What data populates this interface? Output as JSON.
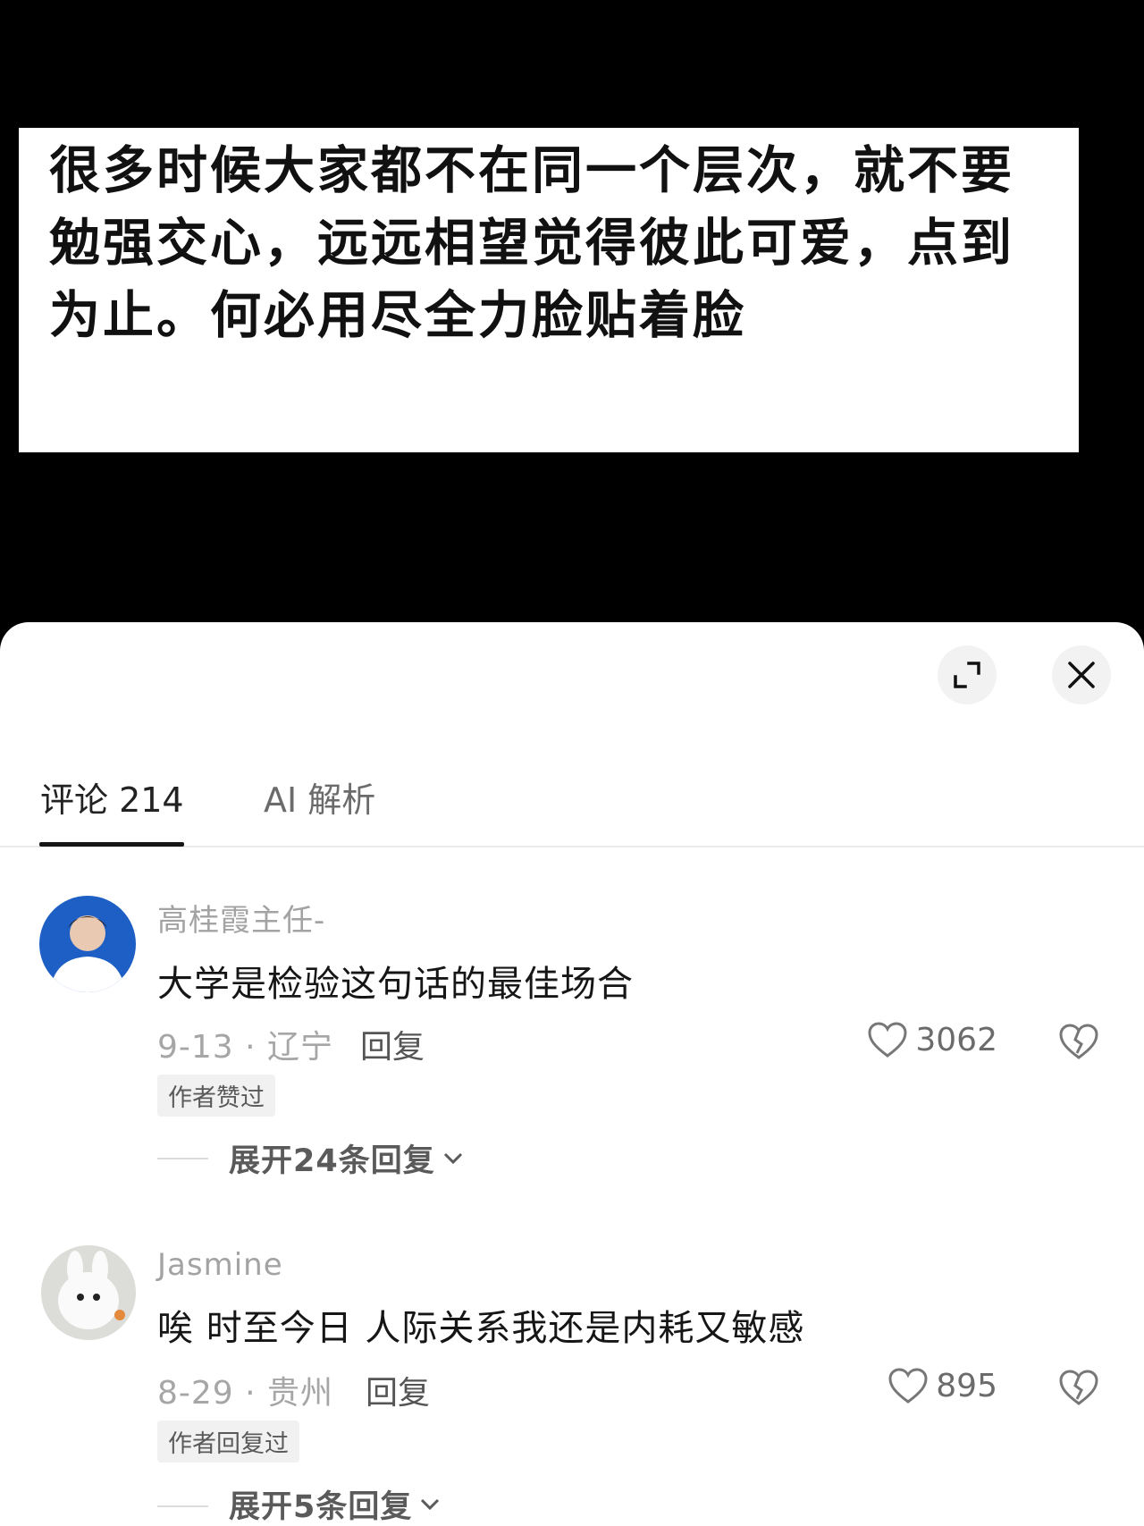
{
  "quote": {
    "text": "很多时候大家都不在同一个层次，就不要勉强交心，远远相望觉得彼此可爱，点到为止。何必用尽全力脸贴着脸"
  },
  "tabs": {
    "comments_label": "评论 214",
    "ai_label": "AI 解析"
  },
  "comments": [
    {
      "username": "高桂霞主任-",
      "text": "大学是检验这句话的最佳场合",
      "date_location": "9-13 · 辽宁",
      "reply_label": "回复",
      "likes": "3062",
      "badge": "作者赞过",
      "expand_label": "展开24条回复"
    },
    {
      "username": "Jasmine",
      "text": "唉 时至今日 人际关系我还是内耗又敏感",
      "date_location": "8-29 · 贵州",
      "reply_label": "回复",
      "likes": "895",
      "badge": "作者回复过",
      "expand_label": "展开5条回复"
    }
  ],
  "icons": {
    "expand": "expand-icon",
    "close": "close-icon",
    "like": "heart-icon",
    "dislike": "broken-heart-icon",
    "chevron": "chevron-down-icon"
  }
}
